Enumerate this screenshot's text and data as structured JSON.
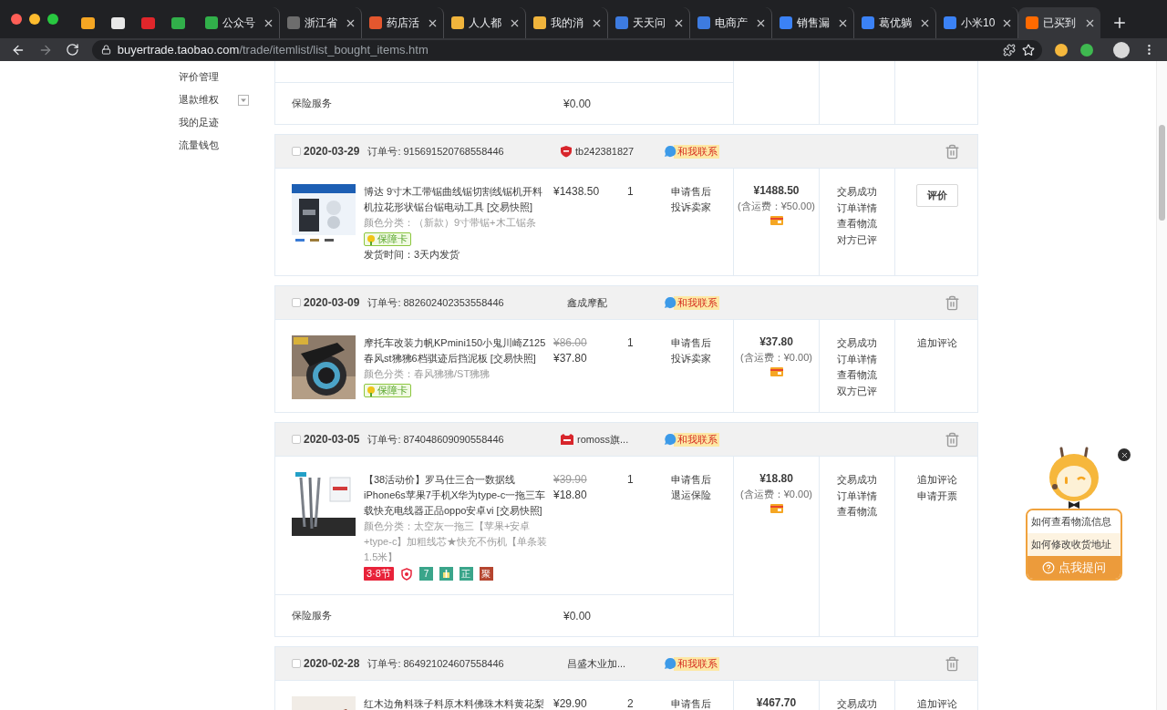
{
  "browser": {
    "pinned_tabs": [
      {
        "color": "#f5a623"
      },
      {
        "color": "#e8e8e8"
      },
      {
        "color": "#e0262b"
      },
      {
        "color": "#31b04a"
      }
    ],
    "tabs": [
      {
        "title": "公众号",
        "selected": false,
        "color": "#31b04a"
      },
      {
        "title": "浙江省",
        "selected": false,
        "color": "#6d6d6d"
      },
      {
        "title": "药店活",
        "selected": false,
        "color": "#e4572e"
      },
      {
        "title": "人人都",
        "selected": false,
        "color": "#f0b43c"
      },
      {
        "title": "我的消",
        "selected": false,
        "color": "#f0b43c"
      },
      {
        "title": "天天问",
        "selected": false,
        "color": "#3d7be0"
      },
      {
        "title": "电商产",
        "selected": false,
        "color": "#3d7be0"
      },
      {
        "title": "销售漏",
        "selected": false,
        "color": "#3b82f6"
      },
      {
        "title": "葛优躺",
        "selected": false,
        "color": "#3b82f6"
      },
      {
        "title": "小米10",
        "selected": false,
        "color": "#3b82f6"
      },
      {
        "title": "已买到",
        "selected": true,
        "color": "#ff6a00"
      }
    ],
    "url": {
      "host": "buyertrade.taobao.com",
      "path": "/trade/itemlist/list_bought_items.htm"
    }
  },
  "sidebar": {
    "items": [
      {
        "label": "评价管理",
        "expandable": false
      },
      {
        "label": "退款维权",
        "expandable": true
      },
      {
        "label": "我的足迹",
        "expandable": false
      },
      {
        "label": "流量钱包",
        "expandable": false
      }
    ]
  },
  "top_remainder": {
    "insurance": {
      "label": "保险服务",
      "price": "¥0.00"
    }
  },
  "orders": [
    {
      "checked": false,
      "date": "2020-03-29",
      "order_no": "订单号: 915691520768558446",
      "shop": {
        "name": "tb242381827",
        "kind": "seller"
      },
      "contact": "和我联系",
      "items": [
        {
          "title": "博达 9寸木工带锯曲线锯切割线锯机开料机拉花形状锯台锯电动工具 [交易快照]",
          "options": "颜色分类：（新款）9寸带锯+木工锯条",
          "price": "¥1438.50",
          "quantity": "1",
          "services": [
            "申请售后",
            "投诉卖家"
          ],
          "badges": [
            {
              "kind": "guarantee",
              "label": "保障卡"
            }
          ],
          "ship_time": "发货时间：3天内发货"
        }
      ],
      "total": "¥1488.50",
      "shipping": "(含运费：¥50.00)",
      "status": [
        "交易成功",
        "订单详情",
        "查看物流",
        "对方已评"
      ],
      "actions": [
        {
          "kind": "button",
          "label": "评价"
        }
      ]
    },
    {
      "checked": false,
      "date": "2020-03-09",
      "order_no": "订单号: 882602402353558446",
      "shop": {
        "name": "鑫成摩配"
      },
      "contact": "和我联系",
      "items": [
        {
          "title": "摩托车改装力帆KPmini150小鬼川崎Z125春风st狒狒6档骐迹后挡泥板 [交易快照]",
          "options": "颜色分类：春风狒狒/ST狒狒",
          "original_price": "¥86.00",
          "price": "¥37.80",
          "quantity": "1",
          "services": [
            "申请售后",
            "投诉卖家"
          ],
          "badges": [
            {
              "kind": "guarantee",
              "label": "保障卡"
            }
          ]
        }
      ],
      "total": "¥37.80",
      "shipping": "(含运费：¥0.00)",
      "status": [
        "交易成功",
        "订单详情",
        "查看物流",
        "双方已评"
      ],
      "actions": [
        {
          "kind": "link",
          "label": "追加评论"
        }
      ]
    },
    {
      "checked": false,
      "date": "2020-03-05",
      "order_no": "订单号: 874048609090558446",
      "shop": {
        "name": "romoss旗...",
        "kind": "tmall"
      },
      "contact": "和我联系",
      "items": [
        {
          "title": "【38活动价】罗马仕三合一数据线iPhone6s苹果7手机X华为type-c一拖三车载快充电线器正品oppo安卓vi [交易快照]",
          "options": "颜色分类：太空灰一拖三【苹果+安卓+type-c】加粗线芯★快充不伤机【单条装1.5米】",
          "original_price": "¥39.90",
          "price": "¥18.80",
          "quantity": "1",
          "services": [
            "申请售后",
            "退运保险"
          ],
          "badges": [
            {
              "kind": "festival",
              "label": "3·8节"
            },
            {
              "kind": "shield"
            },
            {
              "kind": "tag",
              "label": "7",
              "color": "#3aa58a"
            },
            {
              "kind": "gift",
              "color": "#3aa58a"
            },
            {
              "kind": "tag",
              "label": "正",
              "color": "#3aa58a"
            },
            {
              "kind": "tag",
              "label": "聚",
              "color": "#b5452f"
            }
          ]
        }
      ],
      "insurance": {
        "label": "保险服务",
        "price": "¥0.00"
      },
      "total": "¥18.80",
      "shipping": "(含运费：¥0.00)",
      "status": [
        "交易成功",
        "订单详情",
        "查看物流"
      ],
      "actions": [
        {
          "kind": "link",
          "label": "追加评论"
        },
        {
          "kind": "link",
          "label": "申请开票"
        }
      ]
    },
    {
      "checked": false,
      "date": "2020-02-28",
      "order_no": "订单号: 864921024607558446",
      "shop": {
        "name": "昌盛木业加..."
      },
      "contact": "和我联系",
      "items": [
        {
          "title": "红木边角料珠子料原木料佛珠木料黄花梨",
          "price": "¥29.90",
          "quantity": "2",
          "services": [
            "申请售后"
          ]
        }
      ],
      "total": "¥467.70",
      "status": [
        "交易成功"
      ],
      "actions": [
        {
          "kind": "link",
          "label": "追加评论"
        }
      ]
    }
  ],
  "assistant": {
    "questions": [
      {
        "text": "如何查看物流信息",
        "highlighted": false
      },
      {
        "text": "如何修改收货地址",
        "highlighted": true
      }
    ],
    "ask_button": "点我提问"
  }
}
